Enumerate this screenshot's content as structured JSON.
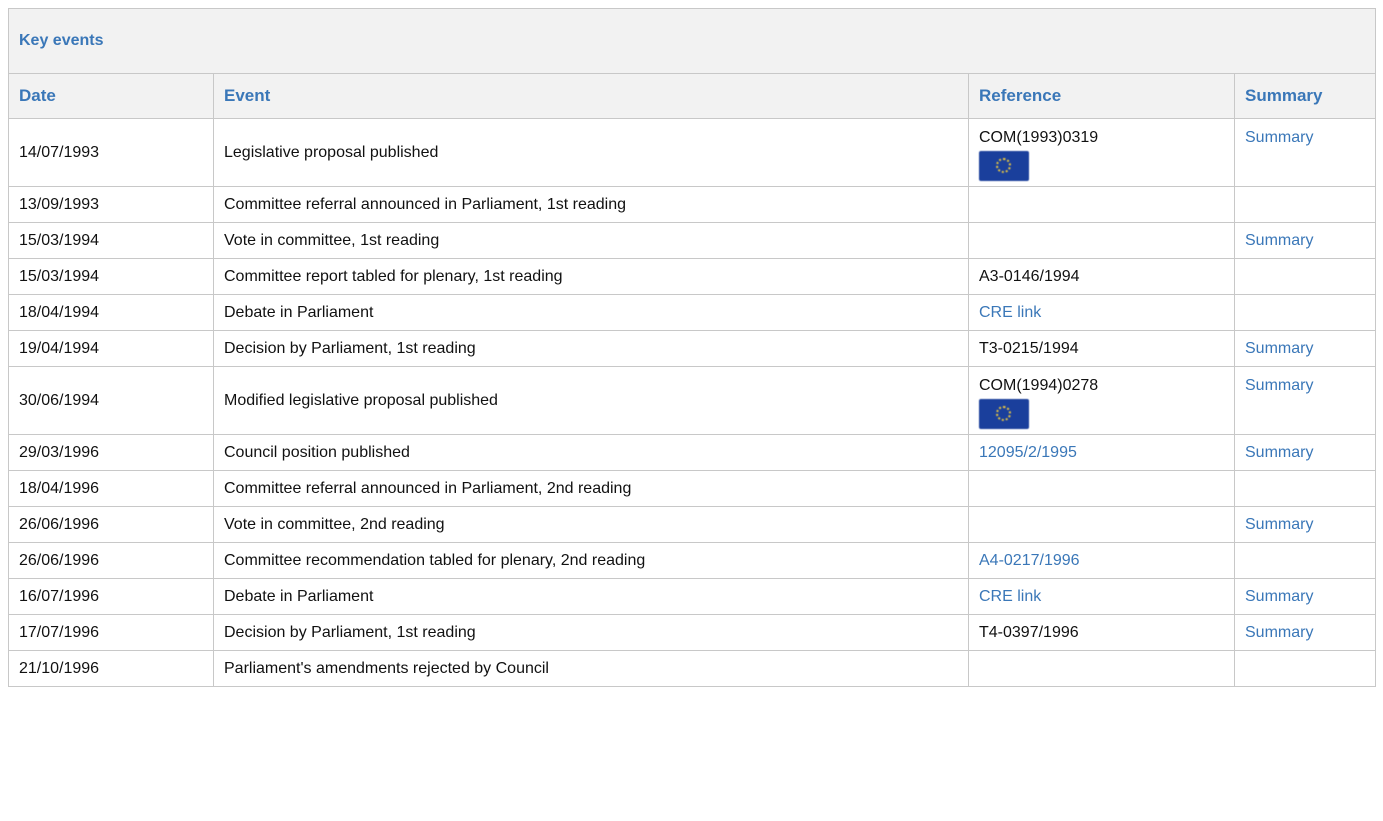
{
  "panel": {
    "title": "Key events"
  },
  "columns": {
    "date": "Date",
    "event": "Event",
    "reference": "Reference",
    "summary": "Summary"
  },
  "rows": [
    {
      "date": "14/07/1993",
      "event": "Legislative proposal published",
      "reference": "COM(1993)0319",
      "reference_is_link": false,
      "flag": true,
      "summary": "Summary"
    },
    {
      "date": "13/09/1993",
      "event": "Committee referral announced in Parliament, 1st reading",
      "reference": "",
      "summary": ""
    },
    {
      "date": "15/03/1994",
      "event": "Vote in committee, 1st reading",
      "reference": "",
      "summary": "Summary"
    },
    {
      "date": "15/03/1994",
      "event": "Committee report tabled for plenary, 1st reading",
      "reference": "A3-0146/1994",
      "reference_is_link": false,
      "summary": ""
    },
    {
      "date": "18/04/1994",
      "event": "Debate in Parliament",
      "reference": "CRE link",
      "reference_is_link": true,
      "summary": ""
    },
    {
      "date": "19/04/1994",
      "event": "Decision by Parliament, 1st reading",
      "reference": "T3-0215/1994",
      "reference_is_link": false,
      "summary": "Summary"
    },
    {
      "date": "30/06/1994",
      "event": "Modified legislative proposal published",
      "reference": "COM(1994)0278",
      "reference_is_link": false,
      "flag": true,
      "summary": "Summary"
    },
    {
      "date": "29/03/1996",
      "event": "Council position published",
      "reference": "12095/2/1995",
      "reference_is_link": true,
      "summary": "Summary"
    },
    {
      "date": "18/04/1996",
      "event": "Committee referral announced in Parliament, 2nd reading",
      "reference": "",
      "summary": ""
    },
    {
      "date": "26/06/1996",
      "event": "Vote in committee, 2nd reading",
      "reference": "",
      "summary": "Summary"
    },
    {
      "date": "26/06/1996",
      "event": "Committee recommendation tabled for plenary, 2nd reading",
      "reference": "A4-0217/1996",
      "reference_is_link": true,
      "summary": ""
    },
    {
      "date": "16/07/1996",
      "event": "Debate in Parliament",
      "reference": "CRE link",
      "reference_is_link": true,
      "summary": "Summary"
    },
    {
      "date": "17/07/1996",
      "event": "Decision by Parliament, 1st reading",
      "reference": "T4-0397/1996",
      "reference_is_link": false,
      "summary": "Summary"
    },
    {
      "date": "21/10/1996",
      "event": "Parliament's amendments rejected by Council",
      "reference": "",
      "summary": ""
    }
  ],
  "colors": {
    "accent": "#3a77b8",
    "header_bg": "#f2f2f2",
    "border": "#c8c8c8"
  },
  "icons": {
    "flag": "eu-flag-icon"
  }
}
